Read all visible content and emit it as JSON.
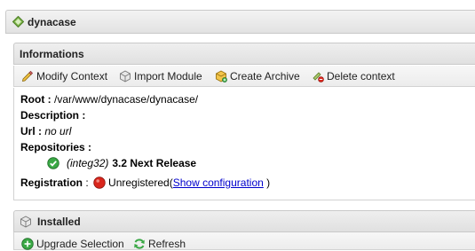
{
  "app": {
    "title": "dynacase"
  },
  "informations": {
    "title": "Informations",
    "toolbar": {
      "modify_context": "Modify Context",
      "import_module": "Import Module",
      "create_archive": "Create Archive",
      "delete_context": "Delete context"
    },
    "root_label": "Root :",
    "root_value": "/var/www/dynacase/dynacase/",
    "description_label": "Description :",
    "url_label": "Url :",
    "url_value": "no url",
    "repositories_label": "Repositories :",
    "repository": {
      "tag": "(integ32)",
      "name": "3.2 Next Release"
    },
    "registration_label": "Registration",
    "registration_sep": " : ",
    "registration_status": "Unregistered(",
    "show_configuration": "Show configuration",
    "registration_close": " )"
  },
  "installed": {
    "title": "Installed",
    "toolbar": {
      "upgrade_selection": "Upgrade Selection",
      "refresh": "Refresh"
    }
  },
  "colors": {
    "ok_green": "#3aa845",
    "error_red": "#d9261c",
    "link_blue": "#0000cc"
  }
}
